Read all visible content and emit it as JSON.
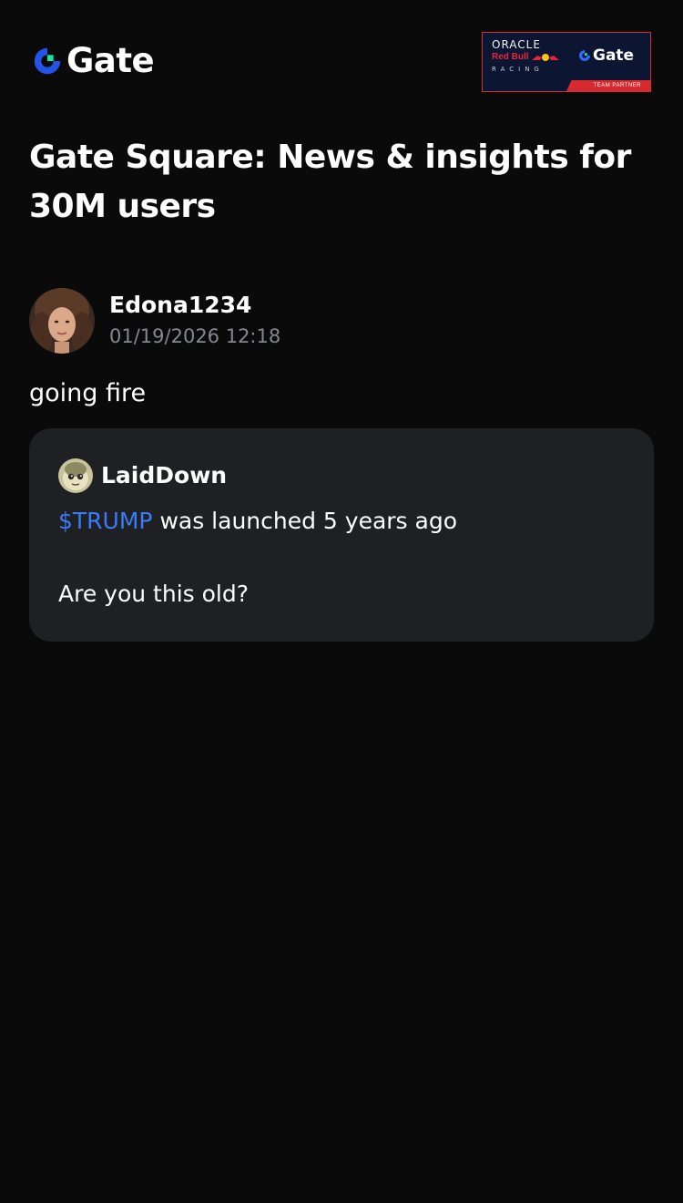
{
  "header": {
    "brand_name": "Gate",
    "partner_badge": {
      "oracle": "ORACLE",
      "redbull": "Red Bull",
      "racing": "RACING",
      "gate": "Gate",
      "tag": "TEAM PARTNER"
    }
  },
  "page_title": "Gate Square: News & insights for 30M users",
  "post": {
    "author": "Edona1234",
    "timestamp": "01/19/2026 12:18",
    "text": "going fire",
    "quote": {
      "author": "LaidDown",
      "ticker": "$TRUMP",
      "line1_rest": " was launched 5 years ago",
      "line2": "Are you this old?"
    }
  },
  "colors": {
    "background": "#0a0a0b",
    "card": "#1f2024",
    "accent_blue": "#3b7bf5",
    "brand_green": "#17e6a1",
    "muted_text": "#84878f",
    "partner_red": "#d62a2e",
    "partner_navy": "#0c1531"
  },
  "icons": {
    "brand_logo": "gate-logo-icon",
    "partner_logo": "gate-logo-icon",
    "bulls": "red-bull-icon"
  }
}
